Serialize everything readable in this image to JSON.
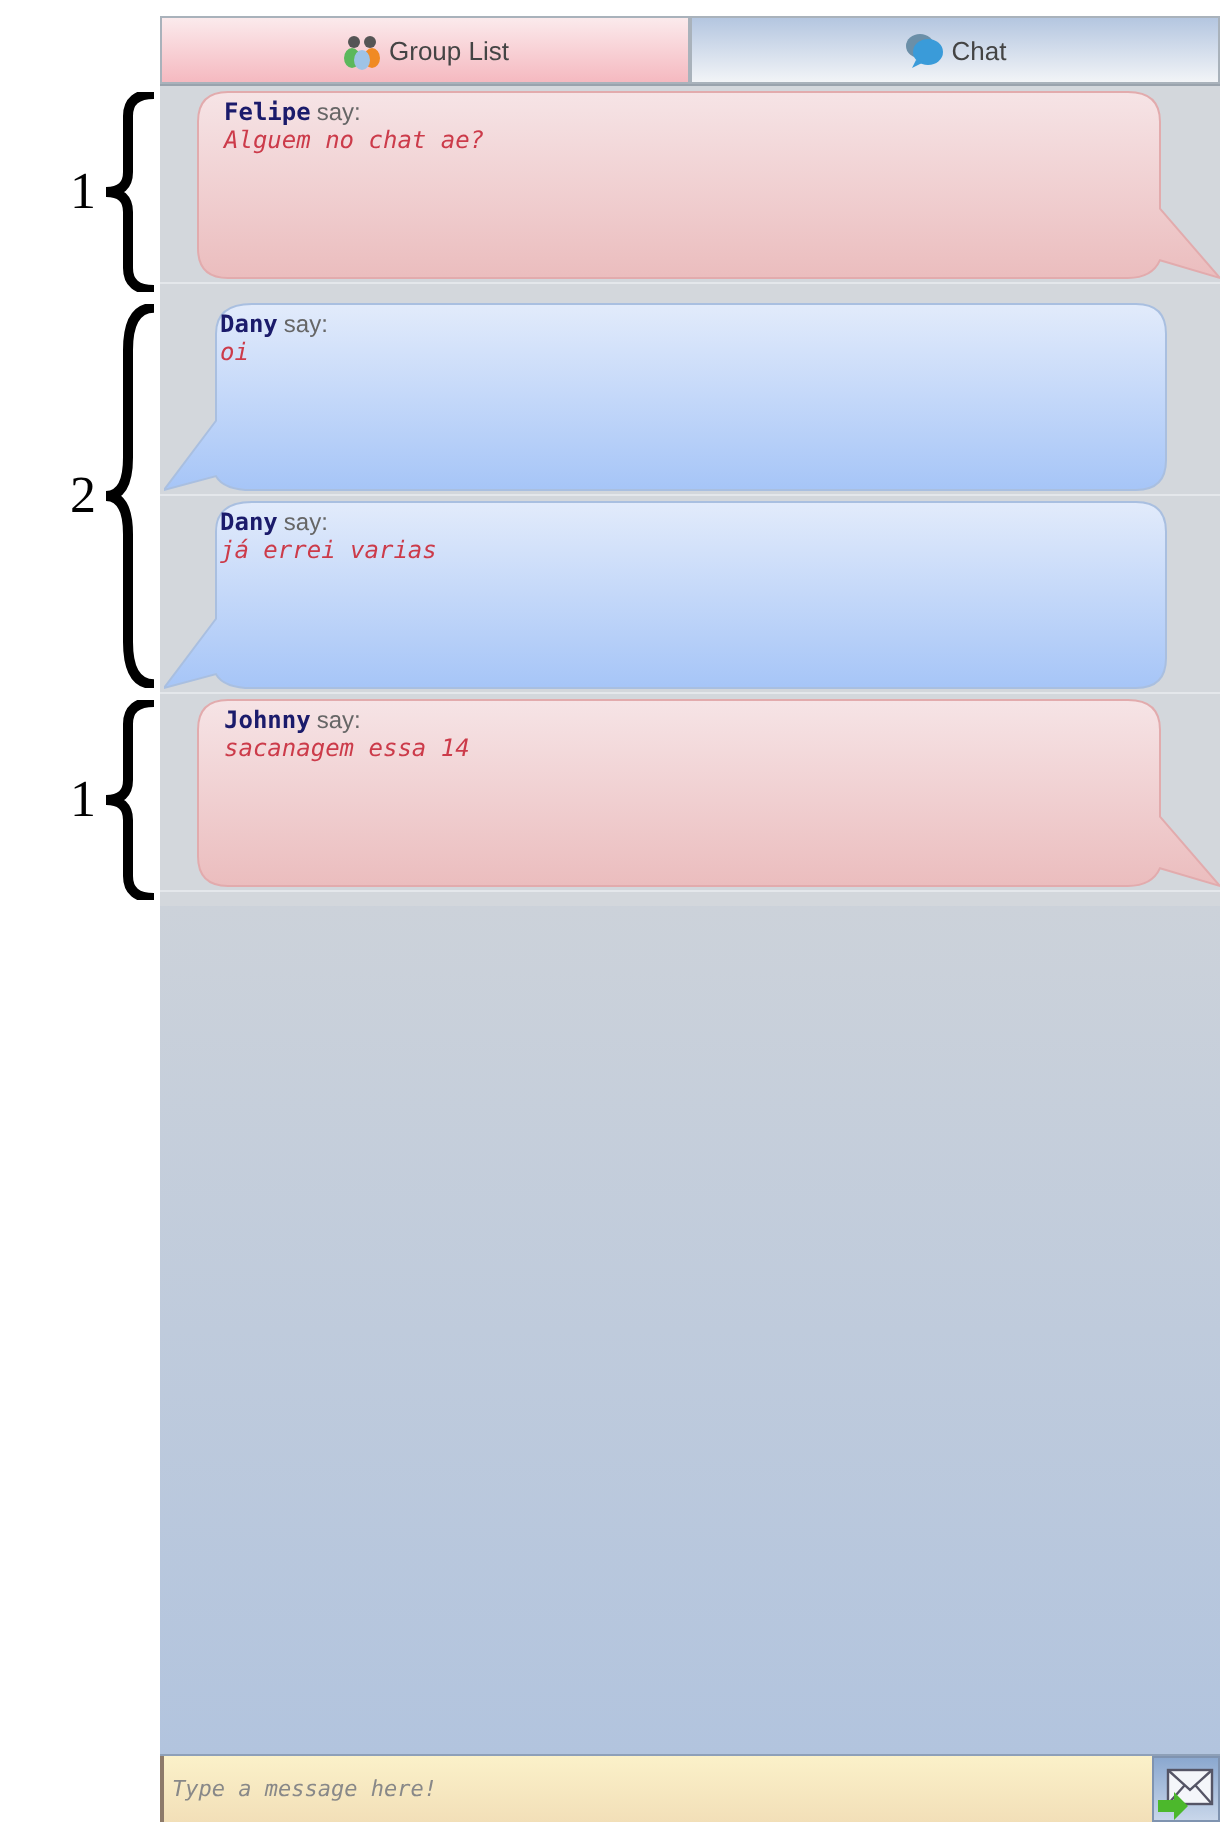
{
  "tabs": [
    {
      "label": "Group List",
      "selected": false
    },
    {
      "label": "Chat",
      "selected": true
    }
  ],
  "groups": [
    {
      "annotation": "1",
      "messages": [
        {
          "kind": "other",
          "sender": "Felipe",
          "verb": "say:",
          "text": "Alguem no chat ae?"
        }
      ]
    },
    {
      "annotation": "2",
      "messages": [
        {
          "kind": "self",
          "sender": "Dany",
          "verb": "say:",
          "text": "oi"
        },
        {
          "kind": "self",
          "sender": "Dany",
          "verb": "say:",
          "text": "já errei varias"
        }
      ]
    },
    {
      "annotation": "1",
      "messages": [
        {
          "kind": "other",
          "sender": "Johnny",
          "verb": "say:",
          "text": "sacanagem essa 14"
        }
      ]
    }
  ],
  "composer": {
    "placeholder": "Type a message here!"
  }
}
